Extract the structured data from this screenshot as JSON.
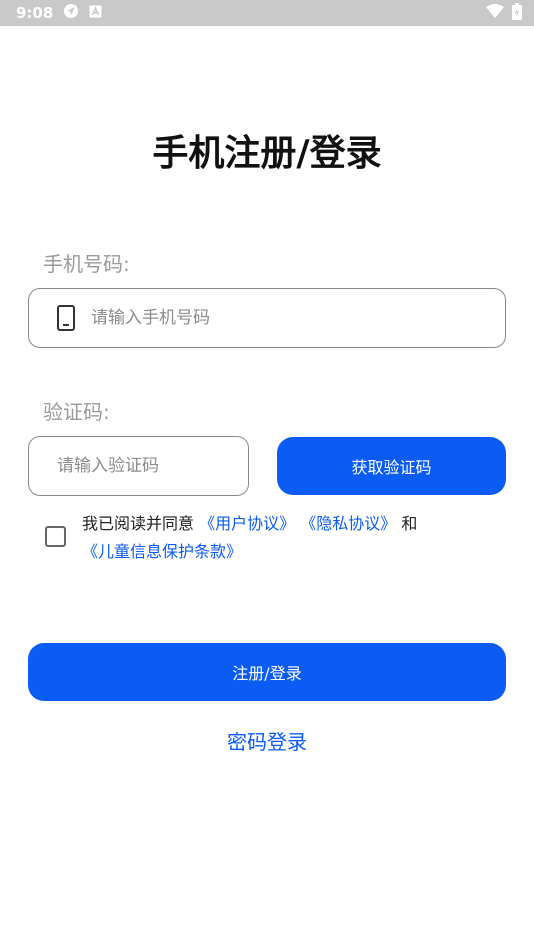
{
  "status_bar": {
    "time": "9:08",
    "icons_left": [
      "navigation-icon",
      "notification-a-icon"
    ],
    "icons_right": [
      "wifi-icon",
      "battery-icon"
    ]
  },
  "title": "手机注册/登录",
  "phone": {
    "label": "手机号码:",
    "placeholder": "请输入手机号码",
    "icon": "phone-icon"
  },
  "code": {
    "label": "验证码:",
    "placeholder": "请输入验证码",
    "button_label": "获取验证码"
  },
  "agreement": {
    "checked": false,
    "prefix": "我已阅读并同意",
    "user_agreement": "《用户协议》",
    "privacy_policy": "《隐私协议》",
    "and": "和",
    "child_policy": "《儿童信息保护条款》"
  },
  "submit_label": "注册/登录",
  "password_login_label": "密码登录",
  "colors": {
    "accent": "#0a5cf5",
    "status_bar": "#c9c9c9",
    "label": "#9a9a9a",
    "border": "#8a8a8a"
  }
}
